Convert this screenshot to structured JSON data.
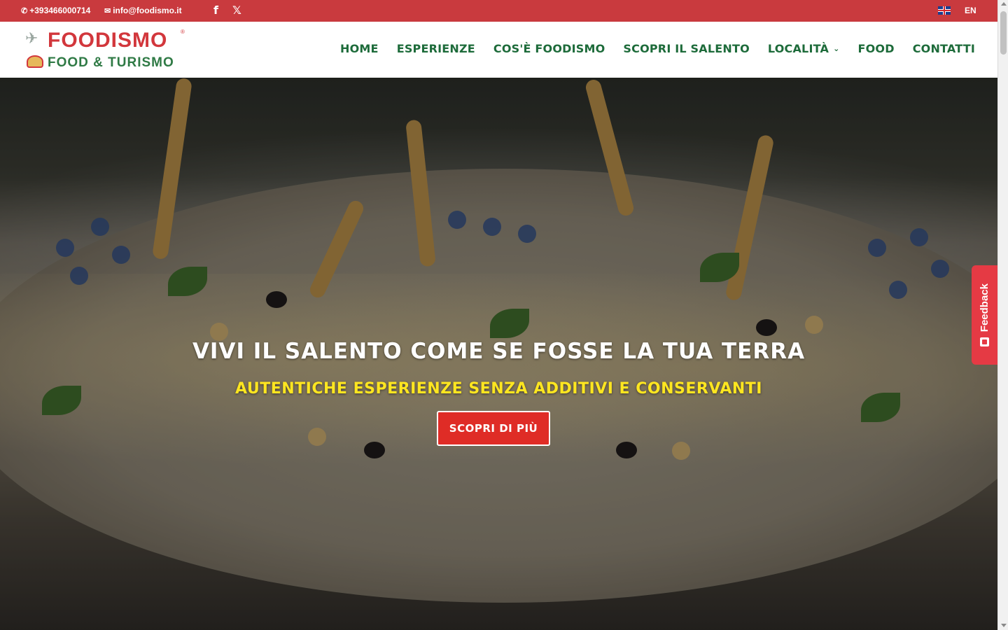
{
  "topbar": {
    "phone": "+393466000714",
    "email": "info@foodismo.it",
    "phone_icon": "phone-icon",
    "email_icon": "envelope-icon",
    "social": [
      {
        "name": "facebook-icon",
        "glyph": "f"
      },
      {
        "name": "x-icon",
        "glyph": "𝕏"
      }
    ],
    "language": "EN",
    "colors": {
      "bar": "#c93a3e"
    }
  },
  "header": {
    "logo": {
      "title": "FOODISMO",
      "subtitle": "FOOD & TURISMO",
      "registered": "®"
    },
    "nav": [
      {
        "label": "HOME"
      },
      {
        "label": "ESPERIENZE"
      },
      {
        "label": "COS'È FOODISMO"
      },
      {
        "label": "SCOPRI IL SALENTO"
      },
      {
        "label": "LOCALITÀ",
        "chevron": "⌄"
      },
      {
        "label": "FOOD"
      },
      {
        "label": "CONTATTI"
      }
    ],
    "colors": {
      "nav": "#1d6b3a",
      "logo_red": "#d2373c",
      "logo_green": "#2f7a45"
    }
  },
  "hero": {
    "title": "VIVI IL SALENTO COME SE FOSSE LA TUA TERRA",
    "subtitle": "AUTENTICHE ESPERIENZE SENZA ADDITIVI E CONSERVANTI",
    "cta": "SCOPRI DI PIÙ",
    "colors": {
      "subtitle": "#ffe620",
      "cta": "#df2c26"
    }
  },
  "feedback": {
    "label": "Feedback",
    "color": "#e53a44"
  }
}
